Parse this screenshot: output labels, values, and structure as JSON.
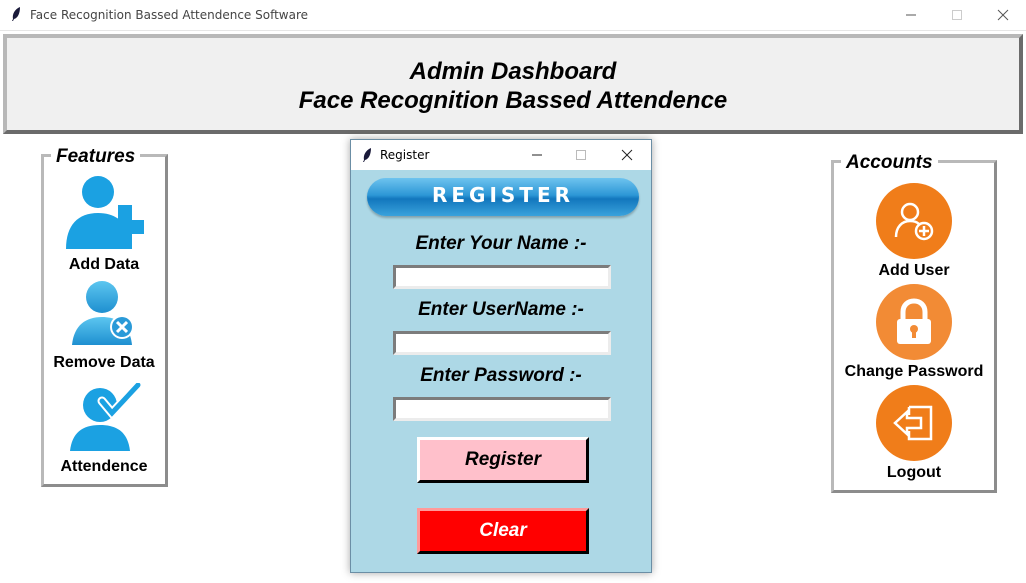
{
  "window": {
    "title": "Face Recognition Bassed Attendence Software"
  },
  "header": {
    "line1": "Admin Dashboard",
    "line2": "Face Recognition Bassed Attendence"
  },
  "features": {
    "legend": "Features",
    "items": [
      {
        "label": "Add Data",
        "icon": "add-user-icon"
      },
      {
        "label": "Remove Data",
        "icon": "remove-user-icon"
      },
      {
        "label": "Attendence",
        "icon": "user-check-icon"
      }
    ]
  },
  "accounts": {
    "legend": "Accounts",
    "items": [
      {
        "label": "Add User",
        "icon": "add-user-icon"
      },
      {
        "label": "Change Password",
        "icon": "lock-icon"
      },
      {
        "label": "Logout",
        "icon": "logout-icon"
      }
    ]
  },
  "dialog": {
    "title": "Register",
    "banner": "REGISTER",
    "name_label": "Enter Your Name :-",
    "name_value": "",
    "username_label": "Enter UserName :-",
    "username_value": "",
    "password_label": "Enter Password :-",
    "password_value": "",
    "register_button": "Register",
    "clear_button": "Clear"
  },
  "colors": {
    "feature_icon": "#1ba1e2",
    "account_icon": "#f07d1a",
    "dialog_bg": "#add8e6",
    "register_button": "#ffc0cb",
    "clear_button": "#ff0000"
  }
}
